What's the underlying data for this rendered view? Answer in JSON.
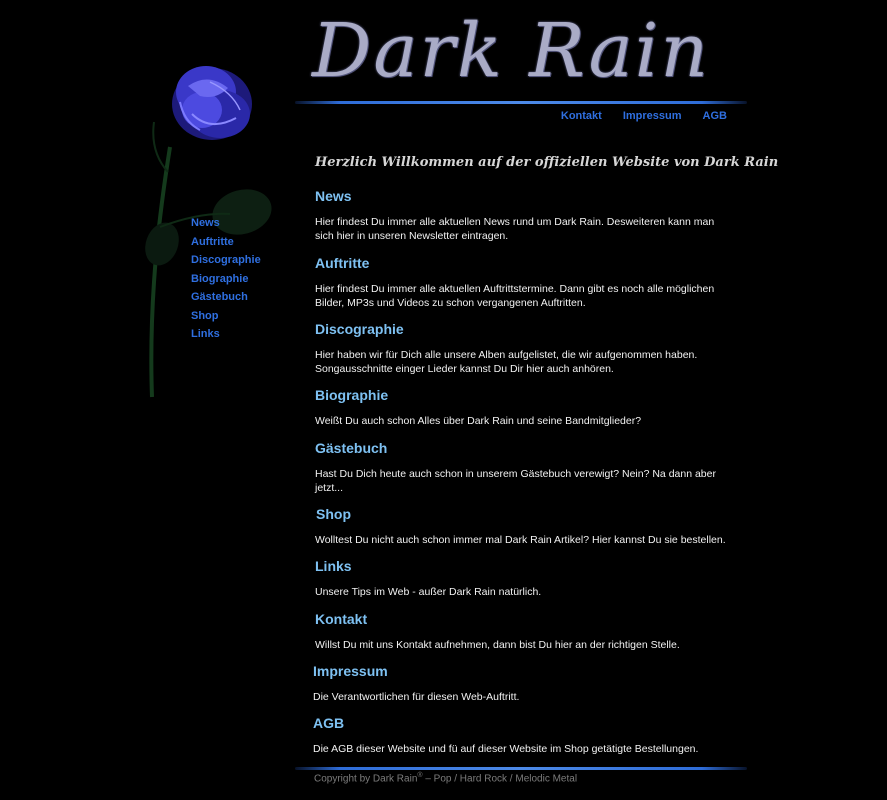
{
  "header": {
    "logo_text": "Dark Rain"
  },
  "top_nav": [
    "Kontakt",
    "Impressum",
    "AGB"
  ],
  "side_nav": [
    "News",
    "Auftritte",
    "Discographie",
    "Biographie",
    "Gästebuch",
    "Shop",
    "Links"
  ],
  "welcome": "Herzlich Willkommen auf der offiziellen Website von Dark Rain",
  "sections": [
    {
      "title": "News",
      "text": "Hier findest Du immer alle aktuellen News rund um Dark Rain. Desweiteren kann man sich hier in unseren Newsletter eintragen."
    },
    {
      "title": "Auftritte",
      "text": "Hier findest Du immer alle aktuellen Auftrittstermine. Dann gibt es noch alle möglichen Bilder, MP3s und Videos zu schon vergangenen Auftritten."
    },
    {
      "title": "Discographie",
      "text": "Hier haben wir für Dich alle unsere Alben aufgelistet, die wir aufgenommen haben. Songausschnitte einger Lieder kannst Du Dir hier auch anhören."
    },
    {
      "title": "Biographie",
      "text": "Weißt Du auch schon Alles über Dark Rain und seine Bandmitglieder?"
    },
    {
      "title": "Gästebuch",
      "text": "Hast Du Dich heute auch schon in unserem Gästebuch verewigt? Nein? Na dann aber jetzt..."
    },
    {
      "title": "Shop",
      "text": "Wolltest Du nicht auch schon immer mal Dark Rain Artikel? Hier kannst Du sie bestellen."
    },
    {
      "title": "Links",
      "text": "Unsere Tips im Web - außer Dark Rain natürlich."
    },
    {
      "title": "Kontakt",
      "text": "Willst Du mit uns Kontakt aufnehmen, dann bist Du hier an der richtigen Stelle."
    },
    {
      "title": "Impressum",
      "text": "Die Verantwortlichen für diesen Web-Auftritt."
    },
    {
      "title": "AGB",
      "text": "Die AGB dieser Website und fü auf dieser Website im Shop getätigte Bestellungen."
    }
  ],
  "footer": {
    "copyright": "Copyright by Dark Rain",
    "mark": "®",
    "tagline": " – Pop / Hard Rock / Melodic Metal"
  }
}
